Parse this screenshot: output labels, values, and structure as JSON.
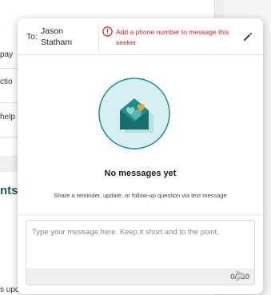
{
  "background": {
    "fragments": [
      "pay",
      "ctio",
      "help"
    ],
    "heading_fragment": "nts",
    "bottom_fragment": "s update on this referral?"
  },
  "header": {
    "to_label": "To:",
    "recipient_name": "Jason Statham",
    "warning_icon": "alert-circle-icon",
    "warning_text": "Add a phone number to message this seeker",
    "edit_icon": "pencil-icon"
  },
  "empty_state": {
    "illustration": "envelope-hearts-icon",
    "title": "No messages yet",
    "subtitle": "Share a reminder, update, or follow-up question via text message"
  },
  "composer": {
    "placeholder": "Type your message here. Keep it short and to the point.",
    "value": "",
    "counter": "0/320",
    "send_icon": "send-icon"
  },
  "colors": {
    "warning": "#c62828",
    "accent_teal": "#1e8f8a",
    "illustration_bg": "#d6eff0",
    "heart_orange": "#f4a52a"
  }
}
